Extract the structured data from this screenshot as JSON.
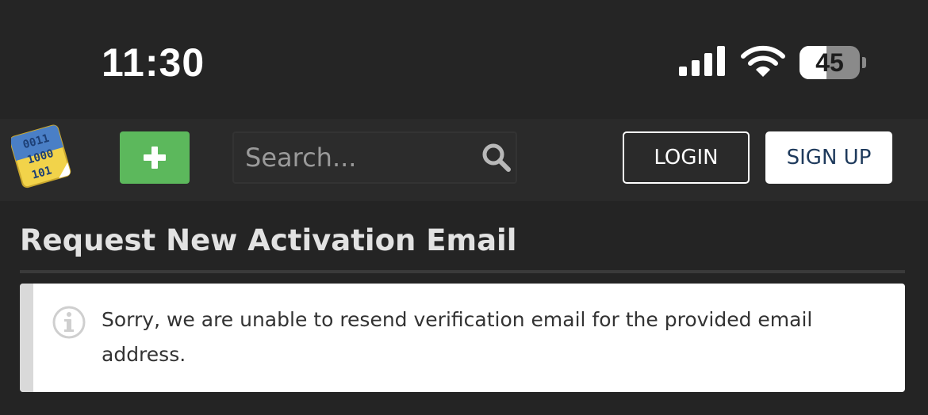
{
  "status_bar": {
    "time": "11:30",
    "battery_level": "45",
    "battery_fraction": 0.45,
    "signal_icon": "cellular-signal-icon",
    "wifi_icon": "wifi-icon",
    "battery_icon": "battery-icon"
  },
  "navbar": {
    "logo_icon": "binary-note-logo",
    "add_icon": "plus-icon",
    "search": {
      "placeholder": "Search...",
      "value": "",
      "icon": "search-icon"
    },
    "login_label": "LOGIN",
    "signup_label": "SIGN UP"
  },
  "main": {
    "title": "Request New Activation Email",
    "alert": {
      "icon": "info-icon",
      "message": "Sorry, we are unable to resend verification email for the provided email address."
    }
  },
  "colors": {
    "background": "#252525",
    "add_button": "#5cb85c",
    "signup_text": "#1e3a5c",
    "alert_background": "#ffffff",
    "alert_bar": "#d9d9d9"
  }
}
